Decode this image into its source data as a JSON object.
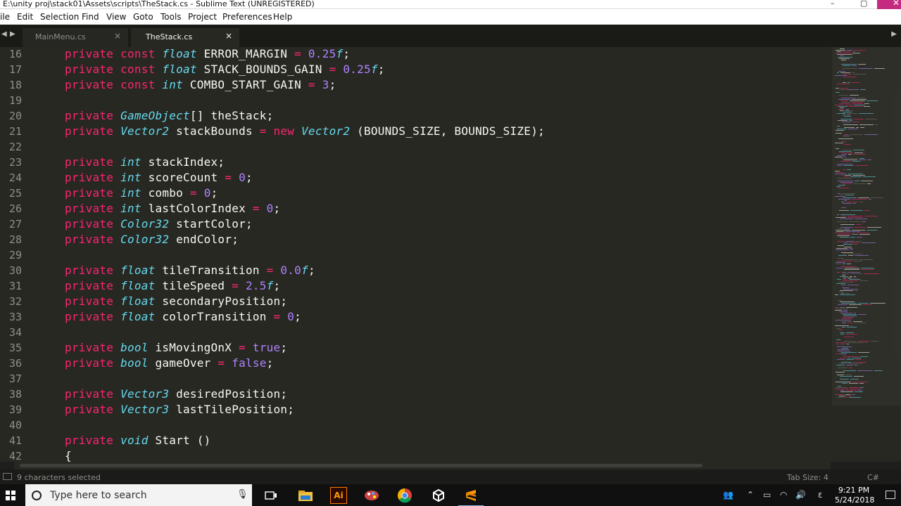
{
  "window": {
    "title": "E:\\unity proj\\stack01\\Assets\\scripts\\TheStack.cs - Sublime Text (UNREGISTERED)",
    "minimize_glyph": "–",
    "maximize_glyph": "▢",
    "close_glyph": "✕"
  },
  "menu": [
    "ile",
    "Edit",
    "Selection",
    "Find",
    "View",
    "Goto",
    "Tools",
    "Project",
    "Preferences",
    "Help"
  ],
  "tabs": [
    {
      "label": "MainMenu.cs",
      "close": "×",
      "active": false
    },
    {
      "label": "TheStack.cs",
      "close": "×",
      "active": true
    }
  ],
  "tab_scroll": {
    "left": "◀",
    "right": "▶"
  },
  "code": {
    "line_numbers": [
      "16",
      "17",
      "18",
      "19",
      "20",
      "21",
      "22",
      "23",
      "24",
      "25",
      "26",
      "27",
      "28",
      "29",
      "30",
      "31",
      "32",
      "33",
      "34",
      "35",
      "36",
      "37",
      "38",
      "39",
      "40",
      "41",
      "42"
    ],
    "lines": [
      {
        "segs": [
          [
            "k",
            "private "
          ],
          [
            "k",
            "const "
          ],
          [
            "t",
            "float"
          ],
          [
            "p",
            " ERROR_MARGIN "
          ],
          [
            "k",
            "="
          ],
          [
            "p",
            " "
          ],
          [
            "n",
            "0.25"
          ],
          [
            "t",
            "f"
          ],
          [
            "p",
            ";"
          ]
        ]
      },
      {
        "segs": [
          [
            "k",
            "private "
          ],
          [
            "k",
            "const "
          ],
          [
            "t",
            "float"
          ],
          [
            "p",
            " STACK_BOUNDS_GAIN "
          ],
          [
            "k",
            "="
          ],
          [
            "p",
            " "
          ],
          [
            "n",
            "0.25"
          ],
          [
            "t",
            "f"
          ],
          [
            "p",
            ";"
          ]
        ]
      },
      {
        "segs": [
          [
            "k",
            "private "
          ],
          [
            "k",
            "const "
          ],
          [
            "t",
            "int"
          ],
          [
            "p",
            " COMBO_START_GAIN "
          ],
          [
            "k",
            "="
          ],
          [
            "p",
            " "
          ],
          [
            "n",
            "3"
          ],
          [
            "p",
            ";"
          ]
        ]
      },
      {
        "segs": []
      },
      {
        "segs": [
          [
            "k",
            "private "
          ],
          [
            "t",
            "GameObject"
          ],
          [
            "p",
            "[] theStack;"
          ]
        ]
      },
      {
        "segs": [
          [
            "k",
            "private "
          ],
          [
            "t",
            "Vector2"
          ],
          [
            "p",
            " stackBounds "
          ],
          [
            "k",
            "="
          ],
          [
            "p",
            " "
          ],
          [
            "k",
            "new "
          ],
          [
            "t",
            "Vector2"
          ],
          [
            "p",
            " (BOUNDS_SIZE, BOUNDS_SIZE);"
          ]
        ]
      },
      {
        "segs": []
      },
      {
        "segs": [
          [
            "k",
            "private "
          ],
          [
            "t",
            "int"
          ],
          [
            "p",
            " stackIndex;"
          ]
        ]
      },
      {
        "segs": [
          [
            "k",
            "private "
          ],
          [
            "t",
            "int"
          ],
          [
            "p",
            " scoreCount "
          ],
          [
            "k",
            "="
          ],
          [
            "p",
            " "
          ],
          [
            "n",
            "0"
          ],
          [
            "p",
            ";"
          ]
        ]
      },
      {
        "segs": [
          [
            "k",
            "private "
          ],
          [
            "t",
            "int"
          ],
          [
            "p",
            " combo "
          ],
          [
            "k",
            "="
          ],
          [
            "p",
            " "
          ],
          [
            "n",
            "0"
          ],
          [
            "p",
            ";"
          ]
        ]
      },
      {
        "segs": [
          [
            "k",
            "private "
          ],
          [
            "t",
            "int"
          ],
          [
            "p",
            " lastColorIndex "
          ],
          [
            "k",
            "="
          ],
          [
            "p",
            " "
          ],
          [
            "n",
            "0"
          ],
          [
            "p",
            ";"
          ]
        ]
      },
      {
        "segs": [
          [
            "k",
            "private "
          ],
          [
            "t",
            "Color32"
          ],
          [
            "p",
            " startColor;"
          ]
        ]
      },
      {
        "segs": [
          [
            "k",
            "private "
          ],
          [
            "t",
            "Color32"
          ],
          [
            "p",
            " endColor;"
          ]
        ]
      },
      {
        "segs": []
      },
      {
        "segs": [
          [
            "k",
            "private "
          ],
          [
            "t",
            "float"
          ],
          [
            "p",
            " tileTransition "
          ],
          [
            "k",
            "="
          ],
          [
            "p",
            " "
          ],
          [
            "n",
            "0.0"
          ],
          [
            "t",
            "f"
          ],
          [
            "p",
            ";"
          ]
        ]
      },
      {
        "segs": [
          [
            "k",
            "private "
          ],
          [
            "t",
            "float"
          ],
          [
            "p",
            " tileSpeed "
          ],
          [
            "k",
            "="
          ],
          [
            "p",
            " "
          ],
          [
            "n",
            "2.5"
          ],
          [
            "t",
            "f"
          ],
          [
            "p",
            ";"
          ]
        ]
      },
      {
        "segs": [
          [
            "k",
            "private "
          ],
          [
            "t",
            "float"
          ],
          [
            "p",
            " secondaryPosition;"
          ]
        ]
      },
      {
        "segs": [
          [
            "k",
            "private "
          ],
          [
            "t",
            "float"
          ],
          [
            "p",
            " colorTransition "
          ],
          [
            "k",
            "="
          ],
          [
            "p",
            " "
          ],
          [
            "n",
            "0"
          ],
          [
            "p",
            ";"
          ]
        ]
      },
      {
        "segs": []
      },
      {
        "segs": [
          [
            "k",
            "private "
          ],
          [
            "t",
            "bool"
          ],
          [
            "p",
            " isMovingOnX "
          ],
          [
            "k",
            "="
          ],
          [
            "p",
            " "
          ],
          [
            "n",
            "true"
          ],
          [
            "p",
            ";"
          ]
        ]
      },
      {
        "segs": [
          [
            "k",
            "private "
          ],
          [
            "t",
            "bool"
          ],
          [
            "p",
            " gameOver "
          ],
          [
            "k",
            "="
          ],
          [
            "p",
            " "
          ],
          [
            "n",
            "false"
          ],
          [
            "p",
            ";"
          ]
        ]
      },
      {
        "segs": []
      },
      {
        "segs": [
          [
            "k",
            "private "
          ],
          [
            "t",
            "Vector3"
          ],
          [
            "p",
            " desiredPosition;"
          ]
        ]
      },
      {
        "segs": [
          [
            "k",
            "private "
          ],
          [
            "t",
            "Vector3"
          ],
          [
            "p",
            " lastTilePosition;"
          ]
        ]
      },
      {
        "segs": []
      },
      {
        "segs": [
          [
            "k",
            "private "
          ],
          [
            "t",
            "void"
          ],
          [
            "p",
            " Start ()"
          ]
        ]
      },
      {
        "segs": [
          [
            "p",
            "{"
          ]
        ]
      }
    ]
  },
  "status": {
    "selection": "9 characters selected",
    "tab_size": "Tab Size: 4",
    "syntax": "C#"
  },
  "taskbar": {
    "search_placeholder": "Type here to search",
    "apps": [
      "task-view",
      "file-explorer",
      "illustrator",
      "paint",
      "chrome",
      "unity",
      "sublime-text"
    ],
    "illustrator_label": "Ai",
    "clock_time": "9:21 PM",
    "clock_date": "5/24/2018",
    "lang": "ε"
  },
  "colors": {
    "keyword": "#f92672",
    "type": "#66d9ef",
    "number": "#ae81ff",
    "plain": "#f8f8f2",
    "editor_bg": "#272822"
  }
}
